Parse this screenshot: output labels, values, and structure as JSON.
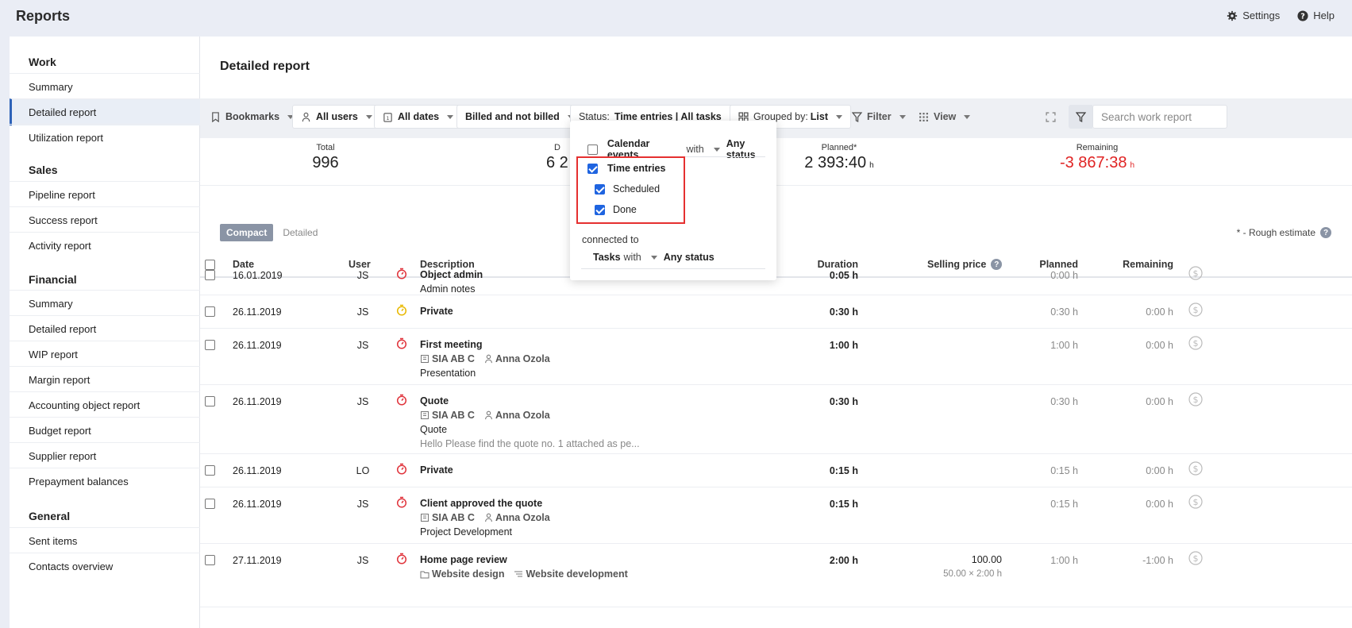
{
  "app": {
    "title": "Reports",
    "settings_label": "Settings",
    "help_label": "Help"
  },
  "sidebar": {
    "sections": [
      {
        "title": "Work",
        "items": [
          "Summary",
          "Detailed report",
          "Utilization report"
        ]
      },
      {
        "title": "Sales",
        "items": [
          "Pipeline report",
          "Success report",
          "Activity report"
        ]
      },
      {
        "title": "Financial",
        "items": [
          "Summary",
          "Detailed report",
          "WIP report",
          "Margin report",
          "Accounting object report",
          "Budget report",
          "Supplier report",
          "Prepayment balances"
        ]
      },
      {
        "title": "General",
        "items": [
          "Sent items",
          "Contacts overview"
        ]
      }
    ],
    "active_item": "Detailed report"
  },
  "page": {
    "title": "Detailed report"
  },
  "toolbar": {
    "bookmarks": "Bookmarks",
    "users": "All users",
    "dates": "All dates",
    "billed": "Billed and not billed",
    "status_prefix": "Status:",
    "status_value": "Time entries | All tasks",
    "grouped_prefix": "Grouped by:",
    "grouped_value": "List",
    "filter": "Filter",
    "view": "View",
    "search_placeholder": "Search work report"
  },
  "stats": {
    "total_label": "Total",
    "total_value": "996",
    "duration_label": "D",
    "duration_value": "6 2",
    "planned_label": "Planned*",
    "planned_value": "2 393:40",
    "planned_unit": "h",
    "remaining_label": "Remaining",
    "remaining_value": "-3 867:38",
    "remaining_unit": "h"
  },
  "view_toggle": {
    "compact": "Compact",
    "detailed": "Detailed"
  },
  "rough_estimate": "* - Rough estimate",
  "table": {
    "headers": {
      "date": "Date",
      "user": "User",
      "description": "Description",
      "duration": "Duration",
      "selling_price": "Selling price",
      "planned": "Planned",
      "remaining": "Remaining"
    },
    "rows": [
      {
        "date": "16.01.2019",
        "user": "JS",
        "status_color": "#e0333b",
        "title": "Object admin",
        "line2": "Admin notes",
        "duration": "0:05 h",
        "planned": "0:00 h",
        "remaining": ""
      },
      {
        "date": "26.11.2019",
        "user": "JS",
        "status_color": "#e8b800",
        "title": "Private",
        "duration": "0:30 h",
        "planned": "0:30 h",
        "remaining": "0:00 h"
      },
      {
        "date": "26.11.2019",
        "user": "JS",
        "status_color": "#e0333b",
        "title": "First meeting",
        "company": "SIA AB C",
        "person": "Anna Ozola",
        "line2": "Presentation",
        "duration": "1:00 h",
        "planned": "1:00 h",
        "remaining": "0:00 h"
      },
      {
        "date": "26.11.2019",
        "user": "JS",
        "status_color": "#e0333b",
        "title": "Quote",
        "company": "SIA AB C",
        "person": "Anna Ozola",
        "line2": "Quote",
        "line3": "Hello Please find the quote no. 1 attached as pe...",
        "duration": "0:30 h",
        "planned": "0:30 h",
        "remaining": "0:00 h"
      },
      {
        "date": "26.11.2019",
        "user": "LO",
        "status_color": "#e0333b",
        "title": "Private",
        "duration": "0:15 h",
        "planned": "0:15 h",
        "remaining": "0:00 h"
      },
      {
        "date": "26.11.2019",
        "user": "JS",
        "status_color": "#e0333b",
        "title": "Client approved the quote",
        "company": "SIA AB C",
        "person": "Anna Ozola",
        "line2": "Project Development",
        "duration": "0:15 h",
        "planned": "0:15 h",
        "remaining": "0:00 h"
      },
      {
        "date": "27.11.2019",
        "user": "JS",
        "status_color": "#e0333b",
        "title": "Home page review",
        "project": "Website design",
        "task": "Website development",
        "duration": "2:00 h",
        "selling": "100.00",
        "selling_sub": "50.00 × 2:00 h",
        "planned": "1:00 h",
        "remaining": "-1:00 h"
      }
    ]
  },
  "status_dropdown": {
    "calendar_label": "Calendar events",
    "with": "with",
    "any_status": "Any status",
    "time_entries": "Time entries",
    "scheduled": "Scheduled",
    "done": "Done",
    "connected_to": "connected to",
    "tasks": "Tasks"
  }
}
